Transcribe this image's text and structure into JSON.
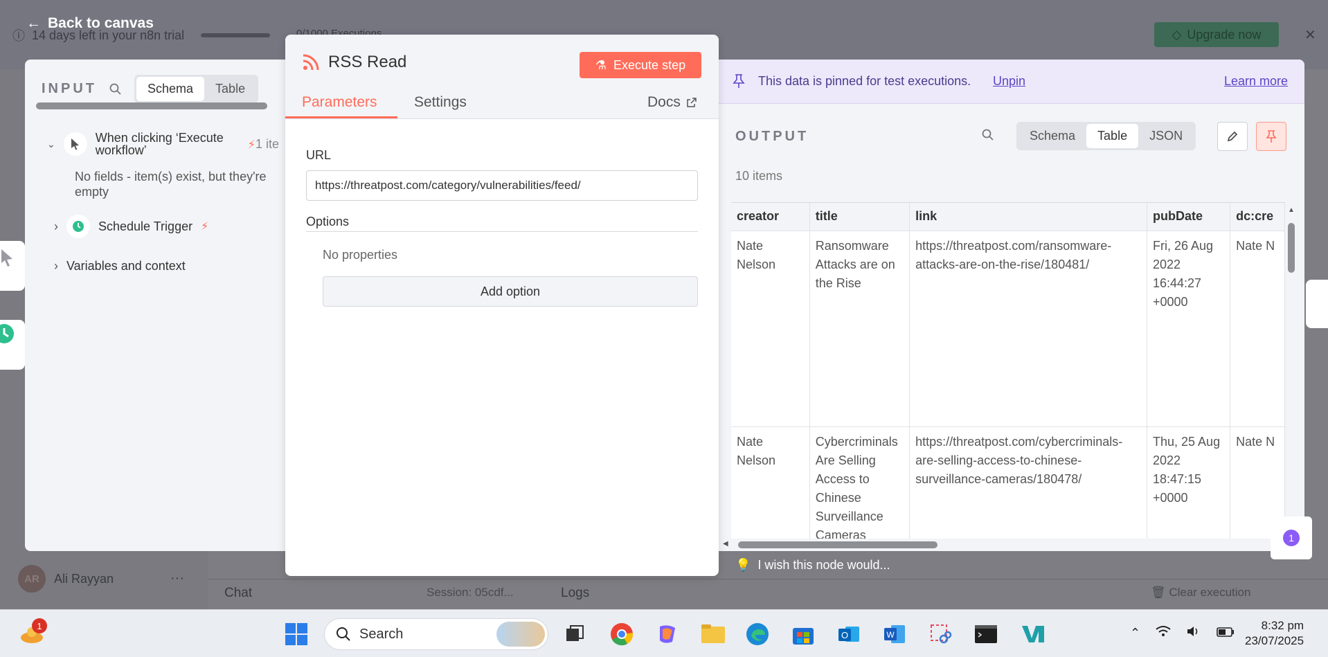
{
  "background": {
    "trial_text": "14 days left in your n8n trial",
    "executions_text": "0/1000 Executions",
    "upgrade_label": "Upgrade now",
    "user_initials": "AR",
    "user_name": "Ali Rayyan",
    "chat_label": "Chat",
    "session_label": "Session: 05cdf...",
    "logs_label": "Logs",
    "clear_label": "Clear execution",
    "wish_text": "I wish this node would..."
  },
  "back_label": "Back to canvas",
  "input": {
    "title": "INPUT",
    "tabs": [
      "Schema",
      "Table"
    ],
    "active_tab": "Schema",
    "tree": [
      {
        "label": "When clicking ‘Execute workflow’",
        "count": "1 ite",
        "note": "No fields - item(s) exist, but they're empty"
      },
      {
        "label": "Schedule Trigger"
      },
      {
        "label": "Variables and context"
      }
    ]
  },
  "modal": {
    "title": "RSS Read",
    "execute_label": "Execute step",
    "tabs": [
      "Parameters",
      "Settings"
    ],
    "active_tab": "Parameters",
    "docs_label": "Docs",
    "url_label": "URL",
    "url_value": "https://threatpost.com/category/vulnerabilities/feed/",
    "options_label": "Options",
    "no_properties": "No properties",
    "add_option_label": "Add option"
  },
  "output": {
    "pinned_text": "This data is pinned for test executions.",
    "unpin_label": "Unpin",
    "learn_more_label": "Learn more",
    "title": "OUTPUT",
    "tabs": [
      "Schema",
      "Table",
      "JSON"
    ],
    "active_tab": "Table",
    "items_count": "10 items",
    "columns": [
      "creator",
      "title",
      "link",
      "pubDate",
      "dc:cre"
    ],
    "rows": [
      {
        "creator": "Nate Nelson",
        "title": "Ransomware Attacks are on the Rise",
        "link": "https://threatpost.com/ransomware-attacks-are-on-the-rise/180481/",
        "pubDate": "Fri, 26 Aug 2022 16:44:27 +0000",
        "dc": "Nate N"
      },
      {
        "creator": "Nate Nelson",
        "title": "Cybercriminals Are Selling Access to Chinese Surveillance Cameras",
        "link": "https://threatpost.com/cybercriminals-are-selling-access-to-chinese-surveillance-cameras/180478/",
        "pubDate": "Thu, 25 Aug 2022 18:47:15 +0000",
        "dc": "Nate N"
      }
    ]
  },
  "float_badge": "1",
  "taskbar": {
    "search_placeholder": "Search",
    "notification_count": "1",
    "time": "8:32 pm",
    "date": "23/07/2025"
  }
}
